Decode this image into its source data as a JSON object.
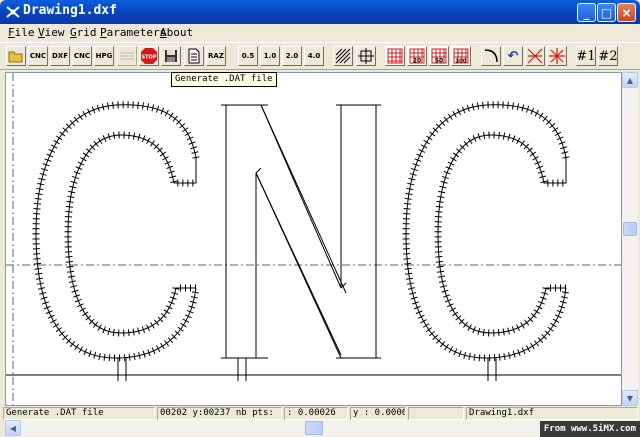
{
  "window": {
    "title": "Drawing1.dxf",
    "minimize": "_",
    "maximize": "□",
    "close": "×"
  },
  "menu": [
    "File",
    "View",
    "Grid",
    "Parameters",
    "About"
  ],
  "toolbar": {
    "buttons": [
      {
        "name": "open",
        "label": ""
      },
      {
        "name": "cnc",
        "label": "CNC"
      },
      {
        "name": "dxf",
        "label": "DXF"
      },
      {
        "name": "cnc2",
        "label": "CNC"
      },
      {
        "name": "hpgl",
        "label": "HPG"
      },
      {
        "name": "disabled",
        "label": ""
      },
      {
        "name": "stop",
        "label": "STOP"
      },
      {
        "name": "save",
        "label": ""
      },
      {
        "name": "generate-dat",
        "label": ""
      },
      {
        "name": "raz",
        "label": "RAZ"
      },
      {
        "name": "scale-05",
        "label": "0.5"
      },
      {
        "name": "scale-10",
        "label": "1.0"
      },
      {
        "name": "scale-20",
        "label": "2.0"
      },
      {
        "name": "scale-40",
        "label": "4.0"
      },
      {
        "name": "hatch",
        "label": ""
      },
      {
        "name": "origin",
        "label": ""
      },
      {
        "name": "grid-1",
        "label": ""
      },
      {
        "name": "grid-20",
        "label": "20"
      },
      {
        "name": "grid-50",
        "label": "50"
      },
      {
        "name": "grid-100",
        "label": "100"
      },
      {
        "name": "arc",
        "label": ""
      },
      {
        "name": "undo",
        "label": "↶"
      },
      {
        "name": "cross-x",
        "label": ""
      },
      {
        "name": "cross-star",
        "label": ""
      },
      {
        "name": "mark-1",
        "label": "#1"
      },
      {
        "name": "mark-2",
        "label": "#2"
      }
    ]
  },
  "tooltip": "Generate .DAT file",
  "status": {
    "message": "Generate .DAT file",
    "coords": "00202 y:00237 nb pts:",
    "x_readout": ": 0.00026",
    "y_readout": "y : 0.0006",
    "filename": "Drawing1.dxf"
  },
  "watermark": "From www.5iMX.com",
  "drawing": {
    "text": "CNC"
  },
  "colors": {
    "guide": "#5a5aa8",
    "accent_red": "#d21a1a"
  }
}
